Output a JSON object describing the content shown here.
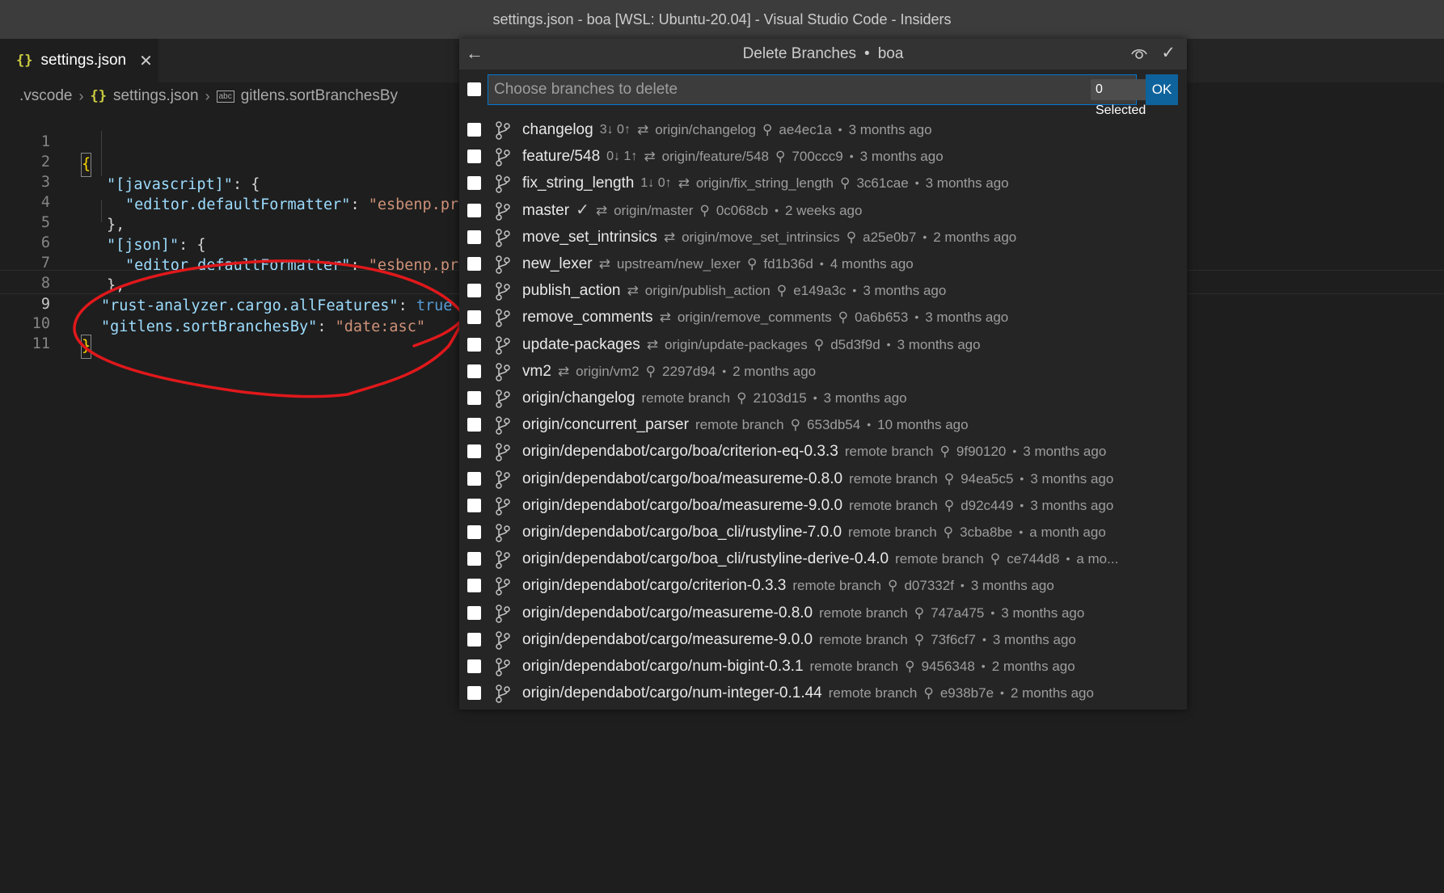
{
  "window": {
    "title": "settings.json - boa [WSL: Ubuntu-20.04] - Visual Studio Code - Insiders"
  },
  "tab": {
    "icon": "{}",
    "label": "settings.json",
    "close": "✕"
  },
  "breadcrumb": {
    "folder": ".vscode",
    "file_icon": "{}",
    "file": "settings.json",
    "symbol_icon": "abc",
    "symbol": "gitlens.sortBranchesBy"
  },
  "editor": {
    "lines": [
      {
        "n": "1",
        "text": "{"
      },
      {
        "n": "2",
        "key": "\"[javascript]\"",
        "rest": ": {"
      },
      {
        "n": "3",
        "key": "\"editor.defaultFormatter\"",
        "sep": ": ",
        "val": "\"esbenp.pr"
      },
      {
        "n": "4",
        "text": "},"
      },
      {
        "n": "5",
        "key": "\"[json]\"",
        "rest": ": {"
      },
      {
        "n": "6",
        "key": "\"editor.defaultFormatter\"",
        "sep": ": ",
        "val": "\"esbenp.pr"
      },
      {
        "n": "7",
        "text": "},"
      },
      {
        "n": "8",
        "key": "\"rust-analyzer.cargo.allFeatures\"",
        "sep": ": ",
        "val": "true"
      },
      {
        "n": "9",
        "key": "\"gitlens.sortBranchesBy\"",
        "sep": ": ",
        "val": "\"date:asc\""
      },
      {
        "n": "10",
        "text": "}"
      },
      {
        "n": "11",
        "text": ""
      }
    ]
  },
  "quickpick": {
    "back_icon": "←",
    "title": "Delete Branches",
    "title_sep": "•",
    "repo": "boa",
    "confirm_icon": "✓",
    "placeholder": "Choose branches to delete",
    "selected_count": "0 Selected",
    "ok_label": "OK",
    "track_icon": "⇄",
    "commit_icon": "⚲",
    "dot": "•",
    "branches": [
      {
        "name": "changelog",
        "ahead": "3↓ 0↑",
        "upstream": "origin/changelog",
        "sha": "ae4ec1a",
        "age": "3 months ago"
      },
      {
        "name": "feature/548",
        "ahead": "0↓ 1↑",
        "upstream": "origin/feature/548",
        "sha": "700ccc9",
        "age": "3 months ago"
      },
      {
        "name": "fix_string_length",
        "ahead": "1↓ 0↑",
        "upstream": "origin/fix_string_length",
        "sha": "3c61cae",
        "age": "3 months ago"
      },
      {
        "name": "master",
        "status": "✓",
        "upstream": "origin/master",
        "sha": "0c068cb",
        "age": "2 weeks ago"
      },
      {
        "name": "move_set_intrinsics",
        "upstream": "origin/move_set_intrinsics",
        "sha": "a25e0b7",
        "age": "2 months ago"
      },
      {
        "name": "new_lexer",
        "upstream": "upstream/new_lexer",
        "sha": "fd1b36d",
        "age": "4 months ago"
      },
      {
        "name": "publish_action",
        "upstream": "origin/publish_action",
        "sha": "e149a3c",
        "age": "3 months ago"
      },
      {
        "name": "remove_comments",
        "upstream": "origin/remove_comments",
        "sha": "0a6b653",
        "age": "3 months ago"
      },
      {
        "name": "update-packages",
        "upstream": "origin/update-packages",
        "sha": "d5d3f9d",
        "age": "3 months ago"
      },
      {
        "name": "vm2",
        "upstream": "origin/vm2",
        "sha": "2297d94",
        "age": "2 months ago"
      },
      {
        "name": "origin/changelog",
        "remote": "remote branch",
        "sha": "2103d15",
        "age": "3 months ago"
      },
      {
        "name": "origin/concurrent_parser",
        "remote": "remote branch",
        "sha": "653db54",
        "age": "10 months ago"
      },
      {
        "name": "origin/dependabot/cargo/boa/criterion-eq-0.3.3",
        "remote": "remote branch",
        "sha": "9f90120",
        "age": "3 months ago"
      },
      {
        "name": "origin/dependabot/cargo/boa/measureme-0.8.0",
        "remote": "remote branch",
        "sha": "94ea5c5",
        "age": "3 months ago"
      },
      {
        "name": "origin/dependabot/cargo/boa/measureme-9.0.0",
        "remote": "remote branch",
        "sha": "d92c449",
        "age": "3 months ago"
      },
      {
        "name": "origin/dependabot/cargo/boa_cli/rustyline-7.0.0",
        "remote": "remote branch",
        "sha": "3cba8be",
        "age": "a month ago"
      },
      {
        "name": "origin/dependabot/cargo/boa_cli/rustyline-derive-0.4.0",
        "remote": "remote branch",
        "sha": "ce744d8",
        "age": "a mo..."
      },
      {
        "name": "origin/dependabot/cargo/criterion-0.3.3",
        "remote": "remote branch",
        "sha": "d07332f",
        "age": "3 months ago"
      },
      {
        "name": "origin/dependabot/cargo/measureme-0.8.0",
        "remote": "remote branch",
        "sha": "747a475",
        "age": "3 months ago"
      },
      {
        "name": "origin/dependabot/cargo/measureme-9.0.0",
        "remote": "remote branch",
        "sha": "73f6cf7",
        "age": "3 months ago"
      },
      {
        "name": "origin/dependabot/cargo/num-bigint-0.3.1",
        "remote": "remote branch",
        "sha": "9456348",
        "age": "2 months ago"
      },
      {
        "name": "origin/dependabot/cargo/num-integer-0.1.44",
        "remote": "remote branch",
        "sha": "e938b7e",
        "age": "2 months ago"
      }
    ]
  },
  "colors": {
    "accent": "#0078d4",
    "ok_button": "#0e639c",
    "annotation": "#e0181b"
  }
}
